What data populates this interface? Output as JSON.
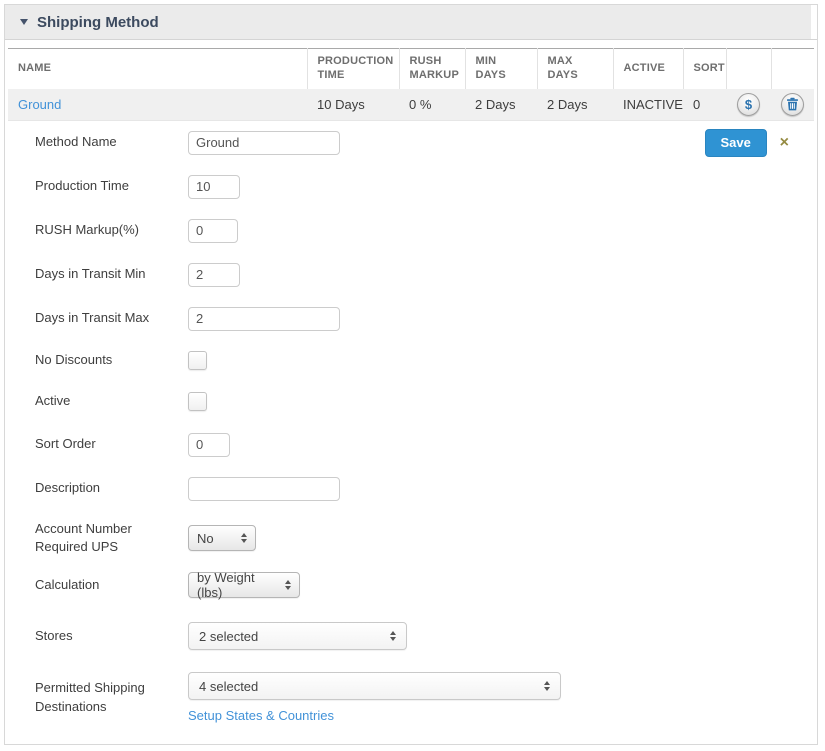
{
  "panel": {
    "title": "Shipping Method"
  },
  "icons": {
    "collapse_caret": "css-triangle-down",
    "dollar": "$",
    "trash": "trash-can",
    "select_arrows": "up-down-triangles",
    "close": "×"
  },
  "colors": {
    "accent_blue": "#2f93d3",
    "link_blue": "#4292d8",
    "icon_blue": "#2a72ae",
    "close_olive": "#958b42",
    "header_bg": "#ebebeb",
    "row_bg": "#f0f0f0",
    "title_text": "#3c4a5f"
  },
  "table": {
    "headers": [
      "NAME",
      "PRODUCTION TIME",
      "RUSH MARKUP",
      "MIN DAYS",
      "MAX DAYS",
      "ACTIVE",
      "SORT",
      "",
      ""
    ],
    "row": {
      "name": "Ground",
      "production_time": "10 Days",
      "rush_markup": "0 %",
      "min_days": "2 Days",
      "max_days": "2 Days",
      "active": "INACTIVE",
      "sort": "0"
    }
  },
  "form": {
    "save_label": "Save",
    "setup_link": "Setup States & Countries",
    "rows": [
      {
        "label": "Method Name",
        "value": "Ground"
      },
      {
        "label": "Production Time",
        "value": "10"
      },
      {
        "label": "RUSH Markup(%)",
        "value": "0"
      },
      {
        "label": "Days in Transit Min",
        "value": "2"
      },
      {
        "label": "Days in Transit Max",
        "value": "2"
      },
      {
        "label": "No Discounts",
        "type": "checkbox",
        "checked": false
      },
      {
        "label": "Active",
        "type": "checkbox",
        "checked": false
      },
      {
        "label": "Sort Order",
        "value": "0"
      },
      {
        "label": "Description",
        "value": ""
      },
      {
        "label": "Account Number Required UPS",
        "value": "No"
      },
      {
        "label": "Calculation",
        "value": "by Weight (lbs)"
      },
      {
        "label": "Stores",
        "value": "2 selected"
      },
      {
        "label": "Permitted Shipping Destinations",
        "value": "4 selected"
      }
    ]
  }
}
